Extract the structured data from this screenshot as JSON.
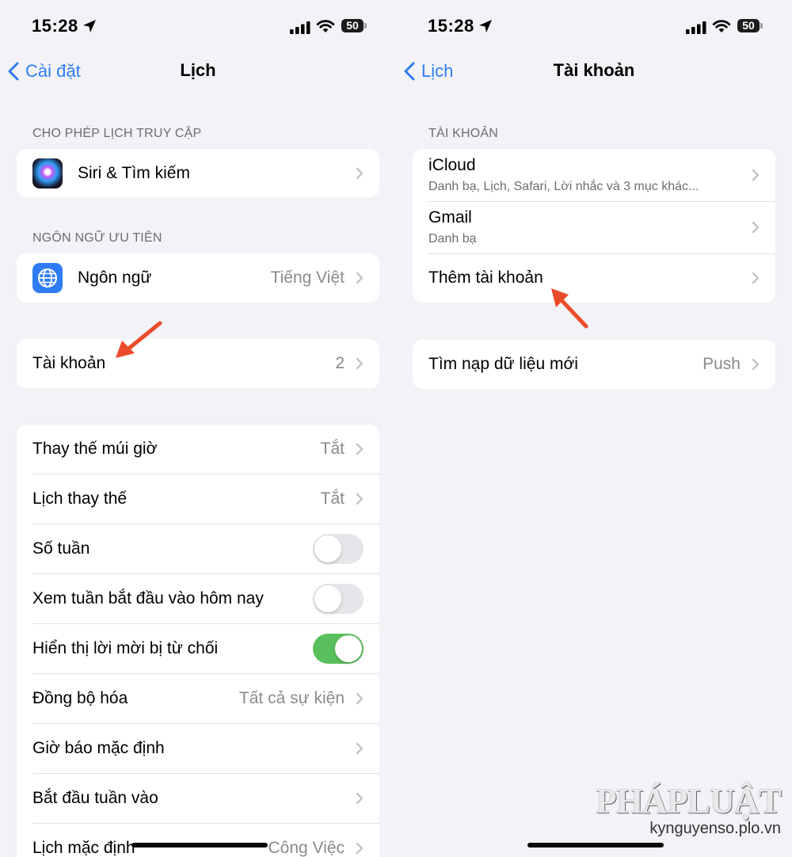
{
  "status_bar": {
    "time": "15:28",
    "battery": "50"
  },
  "left": {
    "back_label": "Cài đặt",
    "title": "Lịch",
    "section_access": "CHO PHÉP LỊCH TRUY CẬP",
    "siri_label": "Siri & Tìm kiếm",
    "section_language": "NGÔN NGỮ ƯU TIÊN",
    "language_label": "Ngôn ngữ",
    "language_value": "Tiếng Việt",
    "accounts_label": "Tài khoản",
    "accounts_value": "2",
    "timezone_label": "Thay thế múi giờ",
    "timezone_value": "Tắt",
    "alt_calendar_label": "Lịch thay thế",
    "alt_calendar_value": "Tắt",
    "week_numbers_label": "Số tuần",
    "week_numbers_on": false,
    "week_today_label": "Xem tuần bắt đầu vào hôm nay",
    "week_today_on": false,
    "declined_label": "Hiển thị lời mời bị từ chối",
    "declined_on": true,
    "sync_label": "Đồng bộ hóa",
    "sync_value": "Tất cả sự kiện",
    "alert_times_label": "Giờ báo mặc định",
    "start_week_label": "Bắt đầu tuần vào",
    "default_calendar_label": "Lịch mặc định",
    "default_calendar_value": "Công Việc"
  },
  "right": {
    "back_label": "Lịch",
    "title": "Tài khoản",
    "section_accounts": "TÀI KHOẢN",
    "icloud_label": "iCloud",
    "icloud_detail": "Danh bạ, Lịch, Safari, Lời nhắc và 3 mục khác...",
    "gmail_label": "Gmail",
    "gmail_detail": "Danh bạ",
    "add_account_label": "Thêm tài khoản",
    "fetch_label": "Tìm nạp dữ liệu mới",
    "fetch_value": "Push"
  },
  "watermark": {
    "brand": "PHÁPLUẬT",
    "site": "kynguyenso.plo.vn"
  },
  "colors": {
    "accent": "#2f7cf6",
    "toggle_on": "#5ac05d",
    "arrow": "#ea4b2a"
  }
}
